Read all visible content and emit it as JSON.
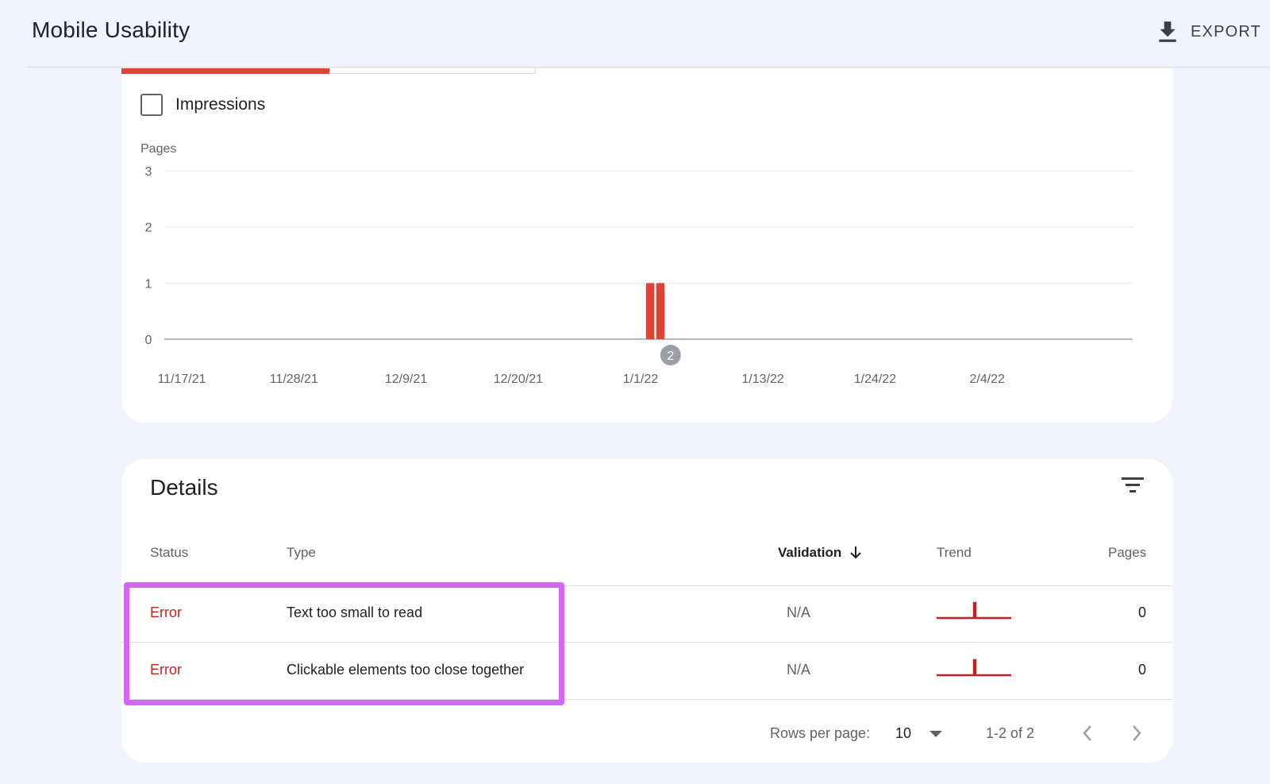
{
  "header": {
    "title": "Mobile Usability",
    "export_label": "EXPORT"
  },
  "chart_controls": {
    "impressions_label": "Impressions",
    "impressions_checked": false
  },
  "chart_data": {
    "type": "bar",
    "ylabel": "Pages",
    "ylim": [
      0,
      3
    ],
    "yticks": [
      "3",
      "2",
      "1",
      "0"
    ],
    "x_tick_labels": [
      "11/17/21",
      "11/28/21",
      "12/9/21",
      "12/20/21",
      "1/1/22",
      "1/13/22",
      "1/24/22",
      "2/4/22"
    ],
    "series": [
      {
        "color": "#db4437",
        "points": [
          {
            "x": "12/31/21",
            "y": 1
          },
          {
            "x": "1/1/22",
            "y": 1
          }
        ]
      }
    ],
    "annotation": {
      "x": "1/2/22",
      "label": "2"
    },
    "grid": true
  },
  "details": {
    "title": "Details",
    "columns": {
      "status": "Status",
      "type": "Type",
      "validation": "Validation",
      "trend": "Trend",
      "pages": "Pages"
    },
    "rows": [
      {
        "status": "Error",
        "type": "Text too small to read",
        "validation": "N/A",
        "pages": "0"
      },
      {
        "status": "Error",
        "type": "Clickable elements too close together",
        "validation": "N/A",
        "pages": "0"
      }
    ],
    "pagination": {
      "rows_per_page_label": "Rows per page:",
      "rows_per_page_value": "10",
      "range": "1-2 of 2"
    }
  },
  "colors": {
    "accent_red": "#db4437",
    "error_text": "#c5221f",
    "highlight": "#d664f5"
  }
}
